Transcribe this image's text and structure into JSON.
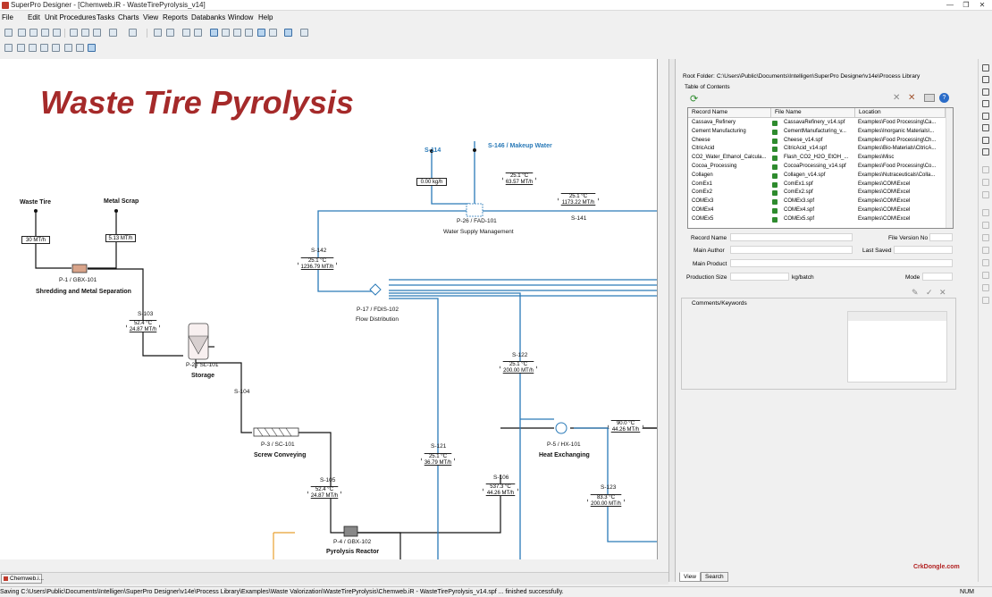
{
  "window": {
    "title": "SuperPro Designer - [Chemweb.iR - WasteTirePyrolysis_v14]",
    "controls": [
      "—",
      "❐",
      "✕"
    ]
  },
  "menu": [
    "File",
    "Edit",
    "Unit Procedures",
    "Tasks",
    "Charts",
    "View",
    "Reports",
    "Databanks",
    "Window",
    "Help"
  ],
  "diagram": {
    "title": "Waste Tire Pyrolysis",
    "streams": {
      "waste_tire": "Waste Tire",
      "metal_scrap": "Metal Scrap",
      "s114": "S-114",
      "s146": "S-146 / Makeup Water",
      "s141": "S-141",
      "s142": "S-142",
      "s103": "S-103",
      "s104": "S-104",
      "s105": "S-105",
      "s106": "S-106",
      "s121": "S-121",
      "s122": "S-122",
      "s123": "S-123"
    },
    "flags": {
      "f_wt": "30 MT/h",
      "f_ms": "5.13 MT/h",
      "f_114": "0.00 kg/h",
      "f_146a": "25.1 °C",
      "f_146b": "63.57 MT/h",
      "f_141a": "25.1 °C",
      "f_141b": "1173.22 MT/h",
      "f_142a": "25.1 °C",
      "f_142b": "1236.79 MT/h",
      "f_103a": "52.4 °C",
      "f_103b": "24.87 MT/h",
      "f_122a": "25.1 °C",
      "f_122b": "200.00 MT/h",
      "f_121a": "25.1 °C",
      "f_121b": "36.79 MT/h",
      "f_105a": "52.4 °C",
      "f_105b": "24.87 MT/h",
      "f_106a": "537.3 °C",
      "f_106b": "44.26 MT/h",
      "f_hxa": "90.0 °C",
      "f_hxb": "44.26 MT/h",
      "f_123a": "83.3 °C",
      "f_123b": "200.00 MT/h"
    },
    "procedures": {
      "p1": "P-1 / GBX-101",
      "p1_name": "Shredding and Metal Separation",
      "p2": "P-2 / SL-101",
      "p2_name": "Storage",
      "p3": "P-3 / SC-101",
      "p3_name": "Screw Conveying",
      "p4": "P-4 / GBX-102",
      "p4_name": "Pyrolysis Reactor",
      "p5": "P-5 / HX-101",
      "p5_name": "Heat Exchanging",
      "p17": "P-17 / FDIS-102",
      "p17_name": "Flow Distribution",
      "p26": "P-26 / FAD-101",
      "p26_name": "Water Supply Management"
    }
  },
  "library": {
    "root_label": "Root Folder:",
    "root_path": "C:\\Users\\Public\\Documents\\Intelligen\\SuperPro Designer\\v14e\\Process Library",
    "toc_label": "Table of Contents",
    "columns": [
      "Record Name",
      "File Name",
      "Location"
    ],
    "rows": [
      [
        "Cassava_Refinery",
        "CassavaRefinery_v14.spf",
        "Examples\\Food Processing\\Ca..."
      ],
      [
        "Cement Manufacturing",
        "CementManufacturing_v...",
        "Examples\\Inorganic Materials\\..."
      ],
      [
        "Cheese",
        "Cheese_v14.spf",
        "Examples\\Food Processing\\Ch..."
      ],
      [
        "CitricAcid",
        "CitricAcid_v14.spf",
        "Examples\\Bio-Materials\\CitricA..."
      ],
      [
        "CO2_Water_Ethanol_Calcula...",
        "Flash_CO2_H2O_EtOH_...",
        "Examples\\Misc"
      ],
      [
        "Cocoa_Processing",
        "CocoaProcessing_v14.spf",
        "Examples\\Food Processing\\Co..."
      ],
      [
        "Collagen",
        "Collagen_v14.spf",
        "Examples\\Nutraceuticals\\Colla..."
      ],
      [
        "ComEx1",
        "ComEx1.spf",
        "Examples\\COM\\Excel"
      ],
      [
        "ComEx2",
        "ComEx2.spf",
        "Examples\\COM\\Excel"
      ],
      [
        "COMEx3",
        "COMEx3.spf",
        "Examples\\COM\\Excel"
      ],
      [
        "COMEx4",
        "COMEx4.spf",
        "Examples\\COM\\Excel"
      ],
      [
        "COMEx5",
        "COMEx5.spf",
        "Examples\\COM\\Excel"
      ]
    ],
    "labels": {
      "record_name": "Record Name",
      "file_version": "File Version No",
      "main_author": "Main Author",
      "last_saved": "Last Saved",
      "main_product": "Main Product",
      "production_size": "Production Size",
      "unit": "kg/batch",
      "mode": "Mode",
      "comments": "Comments/Keywords"
    },
    "tabs": [
      "View",
      "Search"
    ]
  },
  "mdi_tab": "Chemweb.i...",
  "status": {
    "message": "Saving C:\\Users\\Public\\Documents\\Intelligen\\SuperPro Designer\\v14e\\Process Library\\Examples\\Waste Valorization\\WasteTirePyrolysis\\Chemweb.iR - WasteTirePyrolysis_v14.spf ... finished successfully.",
    "num": "NUM"
  },
  "watermark": "CrkDongle.com",
  "colors": {
    "title_red": "#a52a2a",
    "water_blue": "#2a7ab8",
    "accent_orange": "#e8a030"
  }
}
